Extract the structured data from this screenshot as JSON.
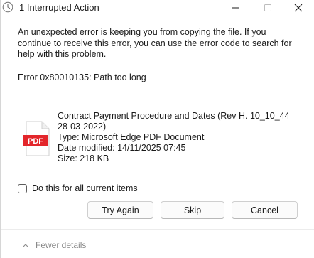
{
  "window": {
    "title": "1 Interrupted Action",
    "icon": "copy-progress-icon",
    "controls": [
      "minimize-icon",
      "maximize-icon",
      "close-icon"
    ]
  },
  "message": {
    "body": "An unexpected error is keeping you from copying the file. If you continue to receive this error, you can use the error code to search for help with this problem.",
    "error_code": "Error 0x80010135: Path too long"
  },
  "file": {
    "icon": "pdf-file-icon",
    "icon_label": "PDF",
    "name_line1": "Contract Payment Procedure and Dates (Rev H. 10_10_44",
    "name_line2": "28-03-2022)",
    "type": "Type: Microsoft Edge PDF Document",
    "modified": "Date modified: 14/11/2025 07:45",
    "size": "Size: 218 KB"
  },
  "options": {
    "apply_all_label": "Do this for all current items",
    "apply_all_checked": false
  },
  "buttons": {
    "try_again": "Try Again",
    "skip": "Skip",
    "cancel": "Cancel"
  },
  "footer": {
    "details_label": "Fewer details",
    "details_icon": "chevron-up-icon"
  },
  "colors": {
    "pdf_red": "#e3262b",
    "muted_text": "#8a8a8a"
  }
}
